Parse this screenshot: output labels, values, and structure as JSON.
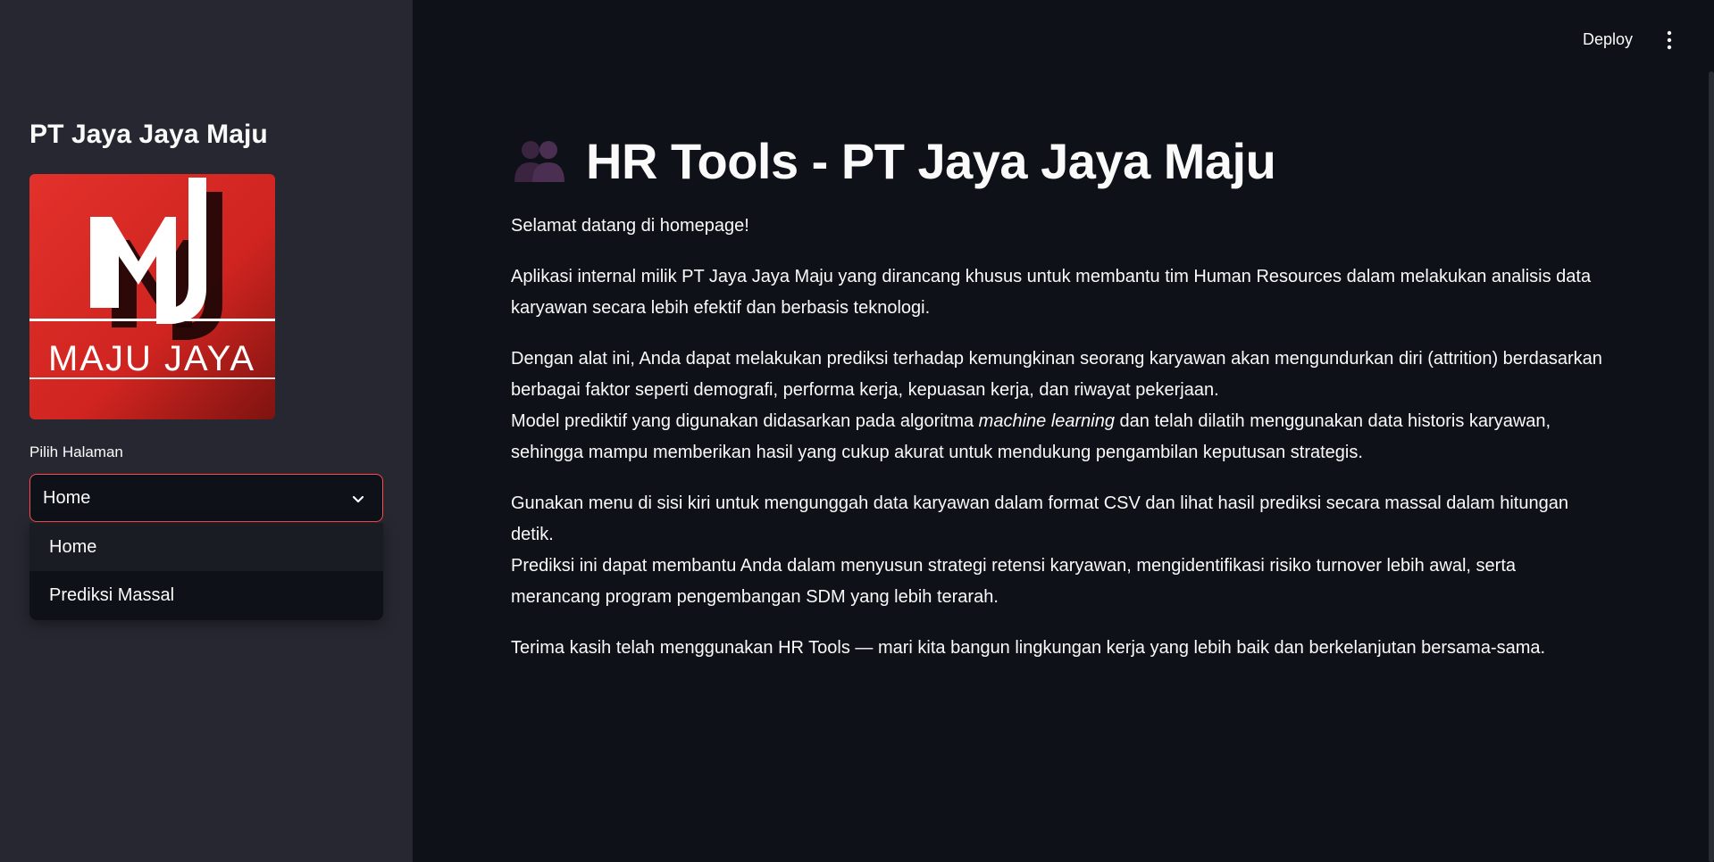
{
  "sidebar": {
    "title": "PT Jaya Jaya Maju",
    "logo": {
      "text": "MAJU JAYA",
      "monogram": "MJ",
      "colors": {
        "primary": "#d9241f",
        "dark": "#8e1512",
        "white": "#ffffff"
      }
    },
    "select": {
      "label": "Pilih Halaman",
      "value": "Home",
      "options": [
        "Home",
        "Prediksi Massal"
      ]
    }
  },
  "header": {
    "deploy_label": "Deploy",
    "menu_icon": "kebab-menu-icon"
  },
  "main": {
    "title_icon": "people-icon",
    "title": "HR Tools - PT Jaya Jaya Maju",
    "welcome": "Selamat datang di homepage!",
    "intro": "Aplikasi internal milik PT Jaya Jaya Maju yang dirancang khusus untuk membantu tim Human Resources dalam melakukan analisis data karyawan secara lebih efektif dan berbasis teknologi.",
    "p2_line1": "Dengan alat ini, Anda dapat melakukan prediksi terhadap kemungkinan seorang karyawan akan mengundurkan diri (attrition) berdasarkan berbagai faktor seperti demografi, performa kerja, kepuasan kerja, dan riwayat pekerjaan.",
    "p2_line2_before": "Model prediktif yang digunakan didasarkan pada algoritma ",
    "p2_line2_em": "machine learning",
    "p2_line2_after": " dan telah dilatih menggunakan data historis karyawan, sehingga mampu memberikan hasil yang cukup akurat untuk mendukung pengambilan keputusan strategis.",
    "p3_line1": "Gunakan menu di sisi kiri untuk mengunggah data karyawan dalam format CSV dan lihat hasil prediksi secara massal dalam hitungan detik.",
    "p3_line2": "Prediksi ini dapat membantu Anda dalam menyusun strategi retensi karyawan, mengidentifikasi risiko turnover lebih awal, serta merancang program pengembangan SDM yang lebih terarah.",
    "closing": "Terima kasih telah menggunakan HR Tools — mari kita bangun lingkungan kerja yang lebih baik dan berkelanjutan bersama-sama."
  },
  "colors": {
    "background": "#0e1117",
    "sidebar": "#262730",
    "text": "#fafafa",
    "accent": "#ff4b4b"
  }
}
